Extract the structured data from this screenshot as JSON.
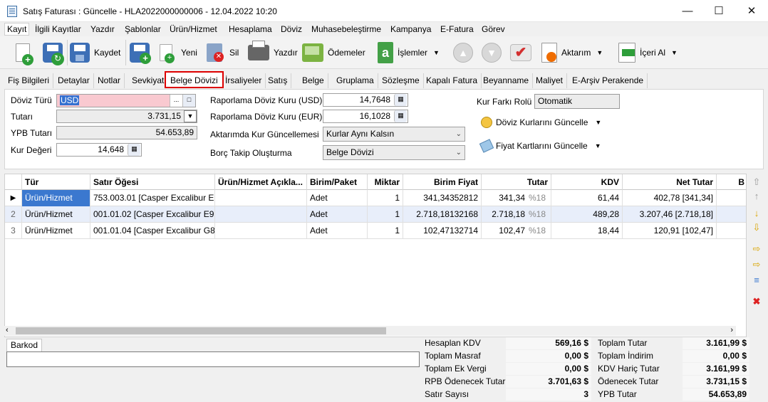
{
  "window": {
    "title": "Satış Faturası : Güncelle - HLA2022000000006 - 12.04.2022 10:20"
  },
  "menu": [
    "Kayıt",
    "İlgili Kayıtlar",
    "Yazdır",
    "Şablonlar",
    "Ürün/Hizmet",
    "Hesaplama",
    "Döviz",
    "Muhasebeleştirme",
    "Kampanya",
    "E-Fatura",
    "Görev"
  ],
  "toolbar": {
    "save": "Kaydet",
    "new": "Yeni",
    "delete": "Sil",
    "print": "Yazdır",
    "payments": "Ödemeler",
    "operations": "İşlemler",
    "transfer": "Aktarım",
    "import": "İçeri Al"
  },
  "tabs": [
    "Fiş Bilgileri",
    "Detaylar",
    "Notlar",
    "Sevkiyat",
    "Belge Dövizi",
    "İrsaliyeler",
    "Satış",
    "Belge",
    "Gruplama",
    "Sözleşme",
    "Kapalı Fatura",
    "Beyanname",
    "Maliyet",
    "E-Arşiv Perakende"
  ],
  "form": {
    "currency_type_label": "Döviz Türü",
    "currency_type": "USD",
    "amount_label": "Tutarı",
    "amount": "3.731,15",
    "ypb_amount_label": "YPB Tutarı",
    "ypb_amount": "54.653,89",
    "rate_value_label": "Kur Değeri",
    "rate_value": "14,648",
    "report_rate_usd_label": "Raporlama Döviz Kuru (USD)",
    "report_rate_usd": "14,7648",
    "report_rate_eur_label": "Raporlama Döviz Kuru (EUR)",
    "report_rate_eur": "16,1028",
    "transfer_rate_update_label": "Aktarımda Kur Güncellemesi",
    "transfer_rate_update": "Kurlar Aynı Kalsın",
    "debt_tracking_label": "Borç Takip Oluşturma",
    "debt_tracking": "Belge Dövizi",
    "rate_diff_role_label": "Kur Farkı Rolü",
    "rate_diff_role": "Otomatik",
    "update_rates": "Döviz Kurlarını Güncelle",
    "update_price_cards": "Fiyat Kartlarını Güncelle"
  },
  "grid": {
    "columns": [
      "Tür",
      "Satır Öğesi",
      "Ürün/Hizmet Açıkla...",
      "Birim/Paket",
      "Miktar",
      "Birim Fiyat",
      "Tutar",
      "KDV",
      "Net Tutar",
      "B"
    ],
    "rows": [
      {
        "n": "",
        "type": "Ürün/Hizmet",
        "item": "753.003.01 [Casper Excalibur E...",
        "desc": "",
        "unit": "Adet",
        "qty": "1",
        "price": "341,34352812",
        "amount": "341,34",
        "vat_rate": "%18",
        "vat": "61,44",
        "net": "402,78 [341,34]"
      },
      {
        "n": "2",
        "type": "Ürün/Hizmet",
        "item": "001.01.02 [Casper Excalibur E9...",
        "desc": "",
        "unit": "Adet",
        "qty": "1",
        "price": "2.718,18132168",
        "amount": "2.718,18",
        "vat_rate": "%18",
        "vat": "489,28",
        "net": "3.207,46 [2.718,18]"
      },
      {
        "n": "3",
        "type": "Ürün/Hizmet",
        "item": "001.01.04 [Casper Excalibur G8...",
        "desc": "",
        "unit": "Adet",
        "qty": "1",
        "price": "102,47132714",
        "amount": "102,47",
        "vat_rate": "%18",
        "vat": "18,44",
        "net": "120,91 [102,47]"
      }
    ]
  },
  "barcode": {
    "tab": "Barkod"
  },
  "summary": {
    "left": [
      {
        "label": "Hesaplan KDV",
        "value": "569,16 $"
      },
      {
        "label": "Toplam Masraf",
        "value": "0,00 $"
      },
      {
        "label": "Toplam Ek Vergi",
        "value": "0,00 $"
      },
      {
        "label": "RPB Ödenecek Tutar",
        "value": "3.701,63 $"
      },
      {
        "label": "Satır Sayısı",
        "value": "3"
      }
    ],
    "right": [
      {
        "label": "Toplam Tutar",
        "value": "3.161,99 $"
      },
      {
        "label": "Toplam İndirim",
        "value": "0,00 $"
      },
      {
        "label": "KDV Hariç Tutar",
        "value": "3.161,99 $"
      },
      {
        "label": "Ödenecek Tutar",
        "value": "3.731,15 $"
      },
      {
        "label": "YPB Tutar",
        "value": "54.653,89"
      }
    ]
  },
  "colors": {
    "accent": "#cc0000",
    "selected_field": "#f9c9d0",
    "row_selected": "#e8eefa"
  }
}
